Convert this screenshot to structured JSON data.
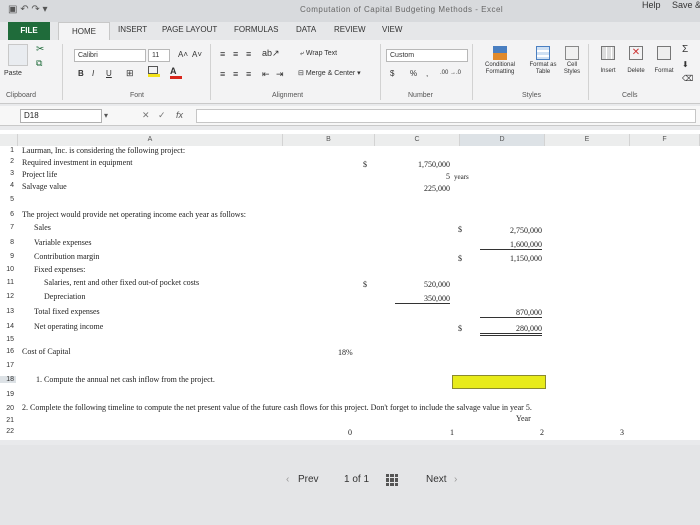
{
  "titlebar": {
    "doc_title": "Computation of Capital Budgeting Methods - Excel",
    "help": "Help",
    "save": "Save & E"
  },
  "tabs": [
    "FILE",
    "HOME",
    "INSERT",
    "PAGE LAYOUT",
    "FORMULAS",
    "DATA",
    "REVIEW",
    "VIEW"
  ],
  "ribbon": {
    "paste": "Paste",
    "font_name": "Calibri",
    "font_size": "11",
    "grow": "A˄",
    "shrink": "A˅",
    "bold": "B",
    "italic": "I",
    "underline": "U",
    "wrap_text": "Wrap Text",
    "merge_center": "Merge & Center",
    "number_format": "Custom",
    "currency": "$",
    "percent": "%",
    "comma": ",",
    "inc_dec": ".00 →.0",
    "conditional": "Conditional\nFormatting",
    "format_as_table": "Format as\nTable",
    "cell_styles": "Cell\nStyles",
    "insert": "Insert",
    "delete": "Delete",
    "format": "Format",
    "groups": {
      "clipboard": "Clipboard",
      "font": "Font",
      "alignment": "Alignment",
      "number": "Number",
      "styles": "Styles",
      "cells": "Cells"
    }
  },
  "formula_bar": {
    "name_box": "D18",
    "cancel": "✕",
    "enter": "✓",
    "fx": "fx",
    "content": ""
  },
  "columns": [
    "A",
    "B",
    "C",
    "D",
    "E",
    "F"
  ],
  "rows": [
    "1",
    "2",
    "3",
    "4",
    "5",
    "6",
    "7",
    "8",
    "9",
    "10",
    "11",
    "12",
    "13",
    "14",
    "15",
    "16",
    "17",
    "18",
    "19",
    "20",
    "21",
    "22"
  ],
  "cells": {
    "a1": "Laurman, Inc. is considering the following project:",
    "a2": "Required investment in equipment",
    "b2": "$",
    "c2": "1,750,000",
    "a3": "Project life",
    "c3": "5",
    "c3u": "years",
    "a4": "Salvage value",
    "c4": "225,000",
    "a6": "The project would provide net operating income each year as follows:",
    "a7": "Sales",
    "c7": "$",
    "d7": "2,750,000",
    "a8": "Variable expenses",
    "d8": "1,600,000",
    "a9": "Contribution margin",
    "c9": "$",
    "d9": "1,150,000",
    "a10": "Fixed expenses:",
    "a11": "Salaries, rent and other fixed out-of pocket costs",
    "b11": "$",
    "c11": "520,000",
    "a12": "Depreciation",
    "c12": "350,000",
    "a13": "Total fixed expenses",
    "d13": "870,000",
    "a14": "Net operating income",
    "c14": "$",
    "d14": "280,000",
    "a16": "Cost of Capital",
    "b16": "18%",
    "a18": "1. Compute the annual net cash inflow from the project.",
    "a20": "2. Complete the following timeline to compute the net present value of the future cash flows for this project. Don't forget to include the salvage value in year 5.",
    "d21": "Year",
    "b22": "0",
    "c22": "1",
    "d22": "2",
    "e22": "3"
  },
  "pager": {
    "prev": "Prev",
    "page": "1 of 1",
    "next": "Next"
  }
}
